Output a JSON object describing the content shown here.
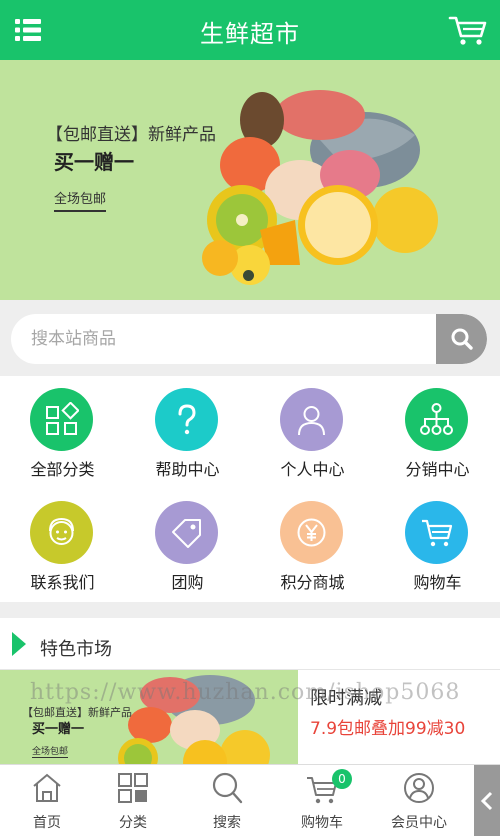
{
  "header": {
    "title": "生鲜超市",
    "menu_icon": "list-menu-icon",
    "cart_icon": "cart-icon",
    "accent": "#19c36b"
  },
  "banner": {
    "promo_tag": "【包邮直送】新鲜产品",
    "promo_main": "买一赠一",
    "promo_sub": "全场包邮",
    "background": "#bfe39c"
  },
  "search": {
    "placeholder": "搜本站商品",
    "button_icon": "search-icon"
  },
  "nav": {
    "items": [
      {
        "label": "全部分类",
        "icon": "grid-shapes-icon",
        "color": "#19c36b"
      },
      {
        "label": "帮助中心",
        "icon": "question-icon",
        "color": "#1ccbc9"
      },
      {
        "label": "个人中心",
        "icon": "user-icon",
        "color": "#a79ad3"
      },
      {
        "label": "分销中心",
        "icon": "network-icon",
        "color": "#19c36b"
      },
      {
        "label": "联系我们",
        "icon": "support-agent-icon",
        "color": "#c7c92b"
      },
      {
        "label": "团购",
        "icon": "tag-icon",
        "color": "#a79ad3"
      },
      {
        "label": "积分商城",
        "icon": "yen-coin-icon",
        "color": "#f9c194"
      },
      {
        "label": "购物车",
        "icon": "cart-icon",
        "color": "#2ab7ea"
      }
    ]
  },
  "feature": {
    "title": "特色市场",
    "thumb": {
      "promo_tag": "【包邮直送】新鲜产品",
      "promo_main": "买一赠一",
      "promo_sub": "全场包邮"
    },
    "deal_title": "限时满减",
    "deal_desc": "7.9包邮叠加99减30",
    "deal_color": "#e8443a"
  },
  "watermark": "https://www.huzhan.com/ishop5068",
  "tabbar": {
    "items": [
      {
        "label": "首页",
        "icon": "home-icon"
      },
      {
        "label": "分类",
        "icon": "category-grid-icon"
      },
      {
        "label": "搜索",
        "icon": "search-icon"
      },
      {
        "label": "购物车",
        "icon": "cart-icon",
        "badge": "0"
      },
      {
        "label": "会员中心",
        "icon": "member-icon"
      }
    ],
    "side_toggle_icon": "chevron-left-icon"
  }
}
